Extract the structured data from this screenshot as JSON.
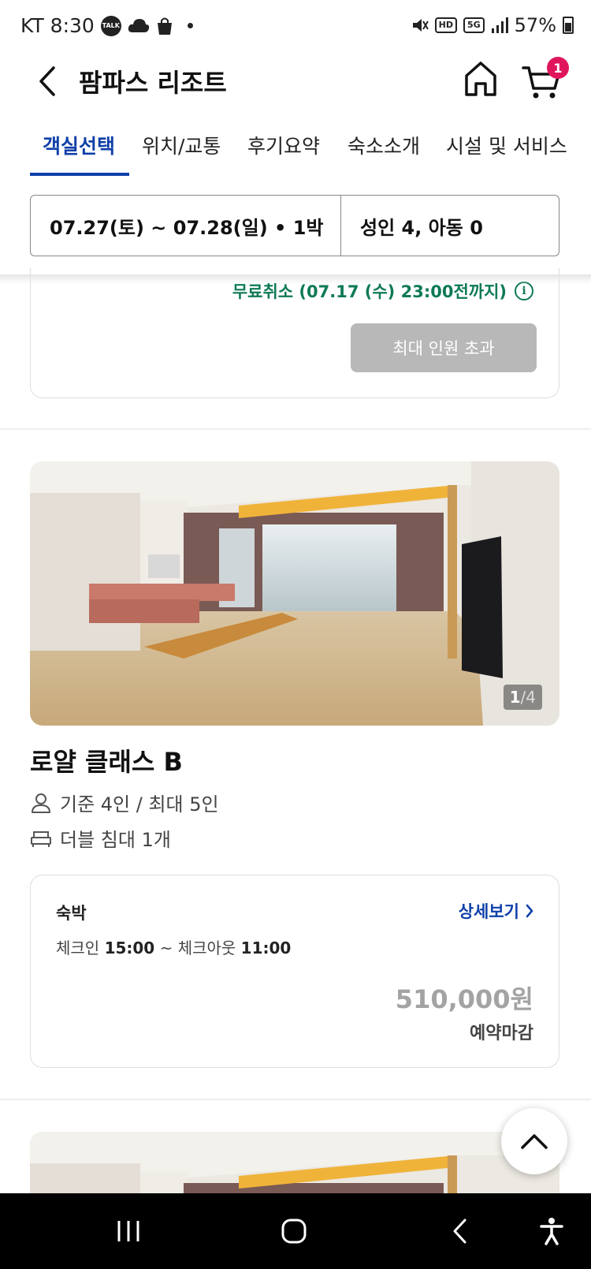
{
  "status_bar": {
    "carrier_time": "KT 8:30",
    "talk_label": "TALK",
    "hd_label": "HD",
    "net_label": "5G",
    "battery": "57%"
  },
  "header": {
    "title": "팜파스 리조트",
    "cart_count": "1"
  },
  "tabs": [
    "객실선택",
    "위치/교통",
    "후기요약",
    "숙소소개",
    "시설 및 서비스"
  ],
  "selector": {
    "dates": "07.27(토) ~ 07.28(일) • 1박",
    "guests": "성인 4, 아동 0"
  },
  "prev_card": {
    "free_cancel": "무료취소 (07.17 (수) 23:00전까지)",
    "info_glyph": "i",
    "button": "최대 인원 초과"
  },
  "room": {
    "photo_index": "1",
    "photo_sep": "/",
    "photo_total": "4",
    "name": "로얄 클래스 B",
    "capacity": "기준 4인 / 최대 5인",
    "bed": "더블 침대 1개"
  },
  "rate": {
    "type": "숙박",
    "detail_link": "상세보기",
    "checkin_label": "체크인 ",
    "checkin_time": "15:00",
    "checkout_label": " ~ 체크아웃 ",
    "checkout_time": "11:00",
    "price": "510,000원",
    "status": "예약마감"
  },
  "colors": {
    "accent": "#0f3fa9",
    "free_cancel": "#0e7a55",
    "badge": "#e0165d",
    "disabled_button": "#b8b8b8"
  }
}
